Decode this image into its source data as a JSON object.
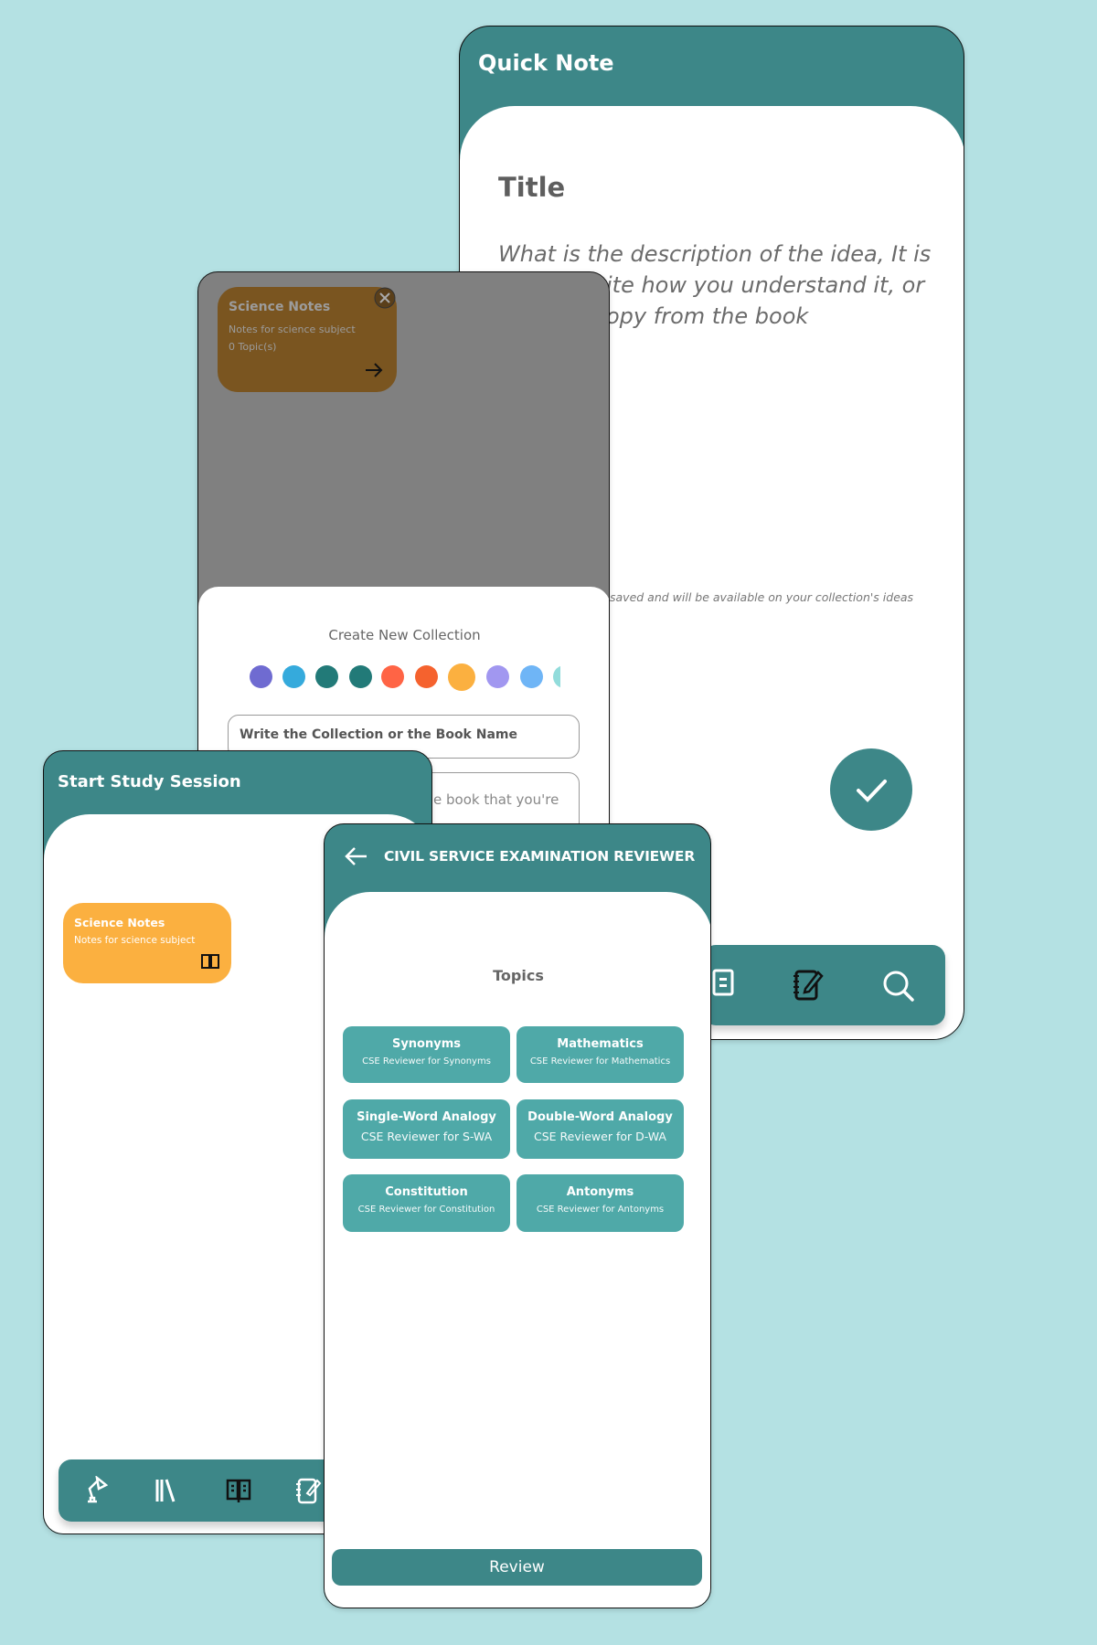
{
  "colors": {
    "background": "#b4e1e3",
    "primary": "#3d8788",
    "tile": "#4fa9a8",
    "accent_orange": "#fbb040"
  },
  "quick_note": {
    "header_title": "Quick Note",
    "title_placeholder": "Title",
    "description_placeholder": "What is the description of the idea, It is ... ite how you understand it, or ... opy from the book",
    "description_lines": [
      "What is the description of the idea, It is",
      "ite how you understand it, or",
      "opy from the book"
    ],
    "save_note": "saved and will be available on your collection's ideas",
    "confirm_icon": "check-icon",
    "nav_icons": [
      "note-icon",
      "notebook-pen-icon",
      "search-icon"
    ]
  },
  "collection": {
    "card": {
      "title": "Science Notes",
      "subtitle": "Notes for science subject",
      "count": "0 Topic(s)",
      "color": "#7a5520"
    },
    "sheet_title": "Create New Collection",
    "color_options": [
      "#6f6bd1",
      "#35aadc",
      "#227a78",
      "#227a78",
      "#ff6445",
      "#f5622e",
      "#fbb040",
      "#a197f0",
      "#6fb5f6",
      "#92dcdb"
    ],
    "selected_color": "#fbb040",
    "name_placeholder": "Write the Collection or the Book Name",
    "description_placeholder": "e book that you're"
  },
  "study_session": {
    "header_title": "Start Study Session",
    "card": {
      "title": "Science Notes",
      "subtitle": "Notes for science subject"
    },
    "nav_icons": [
      "desk-lamp-icon",
      "library-icon",
      "open-book-icon",
      "notebook-pen-icon"
    ]
  },
  "cse": {
    "header_title": "CIVIL SERVICE EXAMINATION REVIEWER",
    "section_title": "Topics",
    "topics": [
      {
        "title": "Synonyms",
        "subtitle": "CSE Reviewer for Synonyms"
      },
      {
        "title": "Mathematics",
        "subtitle": "CSE Reviewer for Mathematics"
      },
      {
        "title": "Single-Word Analogy",
        "subtitle": "CSE Reviewer for S-WA"
      },
      {
        "title": "Double-Word Analogy",
        "subtitle": "CSE Reviewer for D-WA"
      },
      {
        "title": "Constitution",
        "subtitle": "CSE Reviewer for Constitution"
      },
      {
        "title": "Antonyms",
        "subtitle": "CSE Reviewer for Antonyms"
      }
    ],
    "review_label": "Review"
  }
}
